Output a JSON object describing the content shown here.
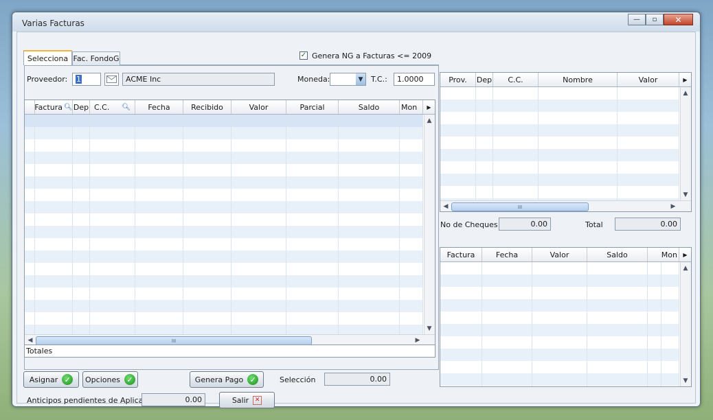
{
  "window": {
    "title": "Varias Facturas"
  },
  "tabs": [
    {
      "label": "Selecciona",
      "active": true
    },
    {
      "label": "Fac. FondoG",
      "active": false
    }
  ],
  "genera_ng": {
    "label": "Genera NG a Facturas <= 2009",
    "checked": true
  },
  "proveedor": {
    "label": "Proveedor:",
    "code": "1",
    "name": "ACME Inc"
  },
  "moneda": {
    "label": "Moneda:",
    "value": ""
  },
  "tc": {
    "label": "T.C.:",
    "value": "1.0000"
  },
  "main_grid": {
    "columns": [
      "Factura",
      "Dep",
      "C.C.",
      "Fecha",
      "Recibido",
      "Valor",
      "Parcial",
      "Saldo",
      "Mon"
    ],
    "totals_label": "Totales"
  },
  "cheques_grid": {
    "columns": [
      "Prov.",
      "Dep",
      "C.C.",
      "Nombre",
      "Valor"
    ]
  },
  "no_cheques": {
    "label": "No de Cheques",
    "value": "0.00"
  },
  "total": {
    "label": "Total",
    "value": "0.00"
  },
  "facturas_grid": {
    "columns": [
      "Factura",
      "Fecha",
      "Valor",
      "Saldo",
      "Mon"
    ]
  },
  "buttons": {
    "asignar": "Asignar",
    "opciones": "Opciones",
    "genera_pago": "Genera Pago",
    "salir": "Salir"
  },
  "seleccion": {
    "label": "Selección",
    "value": "0.00"
  },
  "anticipos": {
    "label": "Anticipos pendientes de Aplicar",
    "value": "0.00"
  },
  "scroll_grip": "III"
}
